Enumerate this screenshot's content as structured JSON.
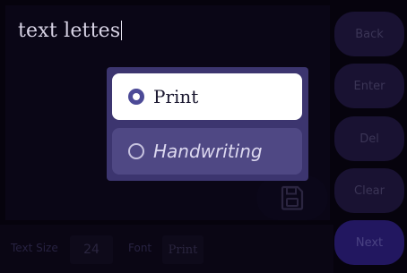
{
  "editor": {
    "text": "text lettes"
  },
  "side_buttons": {
    "back": "Back",
    "enter": "Enter",
    "del": "Del",
    "clear": "Clear",
    "next": "Next"
  },
  "bottom_bar": {
    "text_size_label": "Text Size",
    "text_size_value": "24",
    "font_label": "Font",
    "font_value": "Print"
  },
  "save": {
    "icon": "floppy-disk-icon"
  },
  "font_dialog": {
    "options": [
      {
        "label": "Print",
        "selected": true
      },
      {
        "label": "Handwriting",
        "selected": false
      }
    ]
  },
  "colors": {
    "background": "#06030d",
    "dialog": "#3c356f",
    "selected_option": "#ffffff",
    "unselected_option": "#4f4884",
    "next_button": "#221760"
  }
}
